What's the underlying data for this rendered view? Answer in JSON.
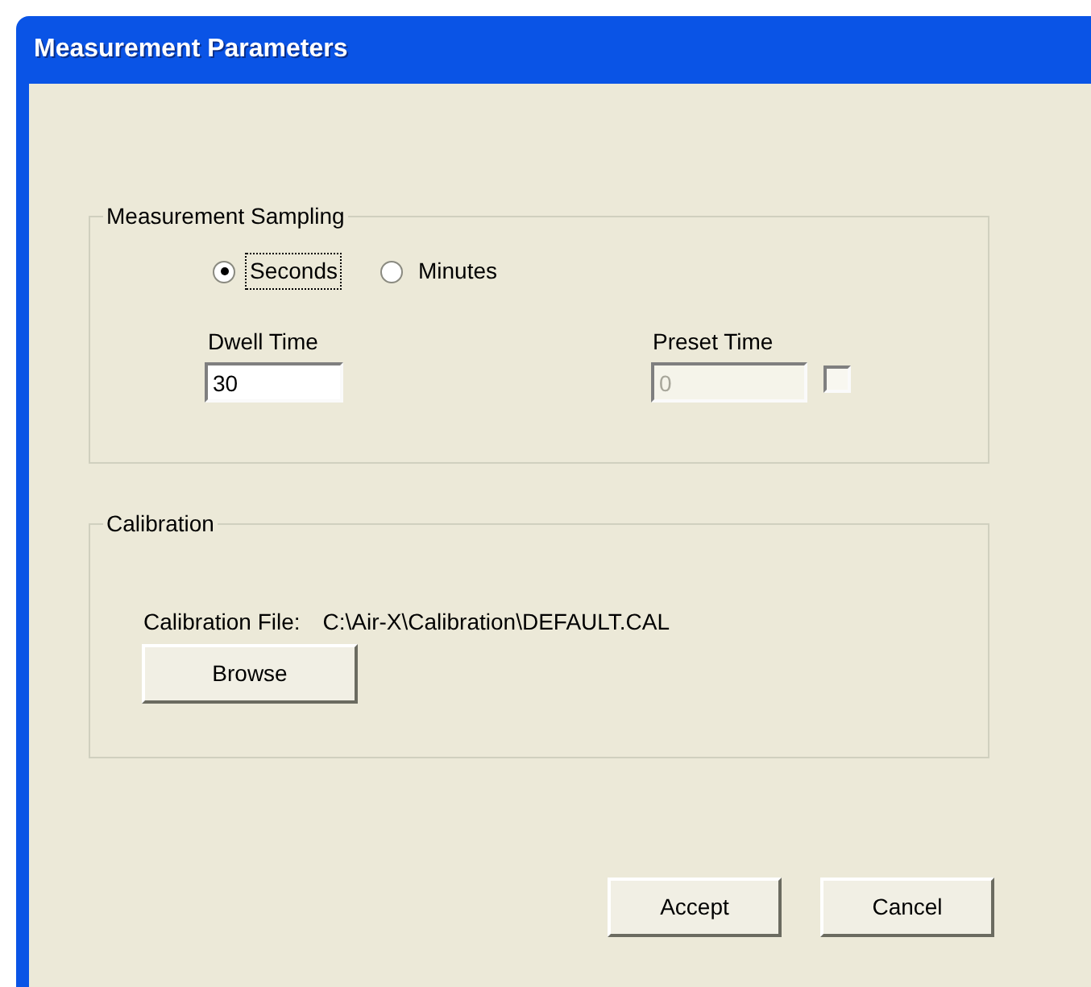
{
  "window": {
    "title": "Measurement Parameters"
  },
  "sampling": {
    "legend": "Measurement Sampling",
    "units": [
      {
        "label": "Seconds",
        "selected": true,
        "focused": true
      },
      {
        "label": "Minutes",
        "selected": false,
        "focused": false
      }
    ],
    "dwell_time": {
      "label": "Dwell Time",
      "value": "30",
      "disabled": false
    },
    "preset_time": {
      "label": "Preset Time",
      "value": "0",
      "disabled": true,
      "checked": false
    }
  },
  "calibration": {
    "legend": "Calibration",
    "file_label": "Calibration File:",
    "file_path": "C:\\Air-X\\Calibration\\DEFAULT.CAL",
    "browse": "Browse"
  },
  "buttons": [
    "Accept",
    "Cancel"
  ]
}
